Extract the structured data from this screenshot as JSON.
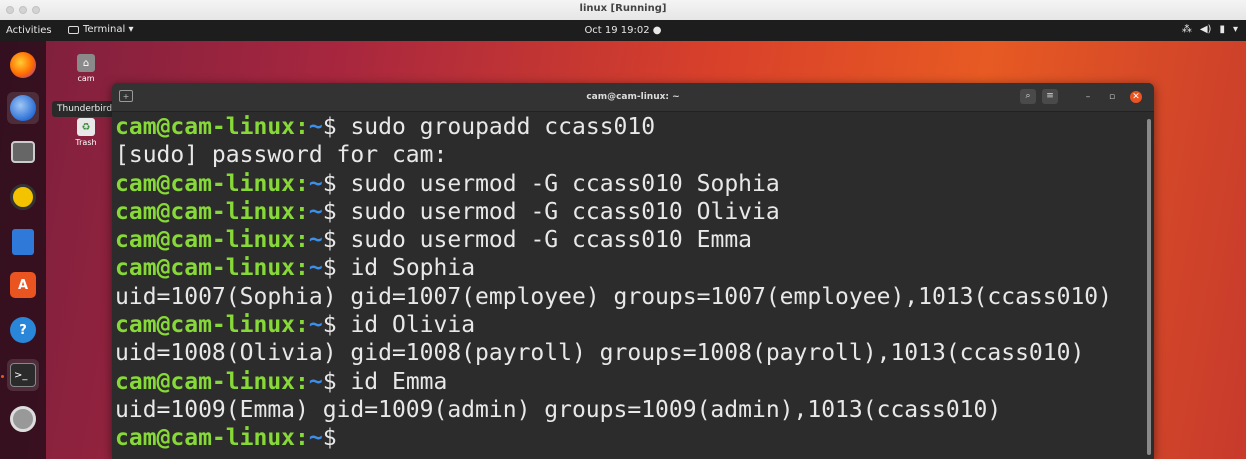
{
  "vm_window": {
    "title": "linux [Running]"
  },
  "topbar": {
    "activities": "Activities",
    "app_menu": "Terminal ▾",
    "clock": "Oct 19  19:02  ●",
    "tray": {
      "network": "⁂",
      "volume": "◀)",
      "battery": "▮",
      "menu": "▾"
    }
  },
  "dock": {
    "tooltip": "Thunderbird Mail",
    "items": [
      {
        "name": "Firefox",
        "icon": "firefox-icon"
      },
      {
        "name": "Thunderbird Mail",
        "icon": "thunderbird-icon"
      },
      {
        "name": "Files",
        "icon": "files-icon"
      },
      {
        "name": "Rhythmbox",
        "icon": "rhythmbox-icon"
      },
      {
        "name": "LibreOffice Writer",
        "icon": "writer-icon"
      },
      {
        "name": "Ubuntu Software",
        "icon": "software-icon",
        "glyph": "A"
      },
      {
        "name": "Help",
        "icon": "help-icon",
        "glyph": "?"
      },
      {
        "name": "Terminal",
        "icon": "terminal-icon",
        "glyph": ">_"
      },
      {
        "name": "Settings",
        "icon": "settings-icon"
      }
    ]
  },
  "desktop_icons": [
    {
      "label": "cam",
      "icon": "home-folder-icon",
      "glyph": "⌂"
    },
    {
      "label": "Trash",
      "icon": "trash-icon",
      "glyph": "♻"
    }
  ],
  "terminal": {
    "title": "cam@cam-linux: ~",
    "header_buttons": {
      "search": "⌕",
      "menu": "≡",
      "minimize": "–",
      "maximize": "▫",
      "close": "✕"
    },
    "prompt_user": "cam@cam-linux:",
    "prompt_path": "~",
    "prompt_symbol": "$",
    "lines": [
      {
        "type": "prompt",
        "command": " sudo groupadd ccass010"
      },
      {
        "type": "output",
        "text": "[sudo] password for cam:"
      },
      {
        "type": "prompt",
        "command": " sudo usermod -G ccass010 Sophia"
      },
      {
        "type": "prompt",
        "command": " sudo usermod -G ccass010 Olivia"
      },
      {
        "type": "prompt",
        "command": " sudo usermod -G ccass010 Emma"
      },
      {
        "type": "prompt",
        "command": " id Sophia"
      },
      {
        "type": "output",
        "text": "uid=1007(Sophia) gid=1007(employee) groups=1007(employee),1013(ccass010)"
      },
      {
        "type": "prompt",
        "command": " id Olivia"
      },
      {
        "type": "output",
        "text": "uid=1008(Olivia) gid=1008(payroll) groups=1008(payroll),1013(ccass010)"
      },
      {
        "type": "prompt",
        "command": " id Emma"
      },
      {
        "type": "output",
        "text": "uid=1009(Emma) gid=1009(admin) groups=1009(admin),1013(ccass010)"
      },
      {
        "type": "prompt",
        "command": ""
      }
    ]
  }
}
